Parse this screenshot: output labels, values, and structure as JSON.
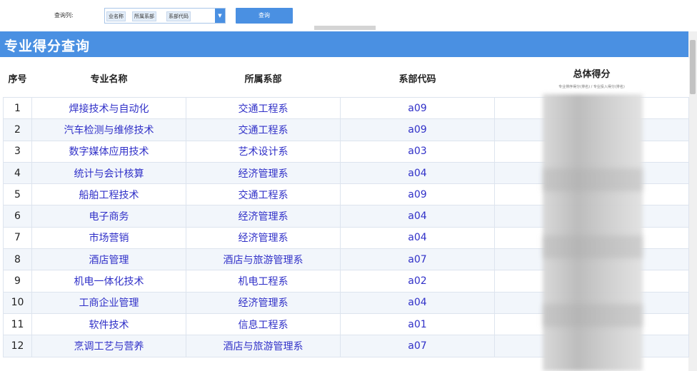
{
  "toolbar": {
    "query_label": "查询列:",
    "selected_tags": [
      "业名称",
      "所属系部",
      "系部代码"
    ],
    "dropdown_arrow": "▼",
    "query_button": "查询"
  },
  "page": {
    "title": "专业得分查询"
  },
  "table": {
    "headers": {
      "index": "序号",
      "major": "专业名称",
      "dept": "所属系部",
      "code": "系部代码",
      "score": "总体得分",
      "score_sub": "专业排序得分(排名) / 专业投入得分(排名)"
    },
    "rows": [
      {
        "index": "1",
        "major": "焊接技术与自动化",
        "dept": "交通工程系",
        "code": "a09"
      },
      {
        "index": "2",
        "major": "汽车检测与维修技术",
        "dept": "交通工程系",
        "code": "a09"
      },
      {
        "index": "3",
        "major": "数字媒体应用技术",
        "dept": "艺术设计系",
        "code": "a03"
      },
      {
        "index": "4",
        "major": "统计与会计核算",
        "dept": "经济管理系",
        "code": "a04"
      },
      {
        "index": "5",
        "major": "船舶工程技术",
        "dept": "交通工程系",
        "code": "a09"
      },
      {
        "index": "6",
        "major": "电子商务",
        "dept": "经济管理系",
        "code": "a04"
      },
      {
        "index": "7",
        "major": "市场营销",
        "dept": "经济管理系",
        "code": "a04"
      },
      {
        "index": "8",
        "major": "酒店管理",
        "dept": "酒店与旅游管理系",
        "code": "a07"
      },
      {
        "index": "9",
        "major": "机电一体化技术",
        "dept": "机电工程系",
        "code": "a02"
      },
      {
        "index": "10",
        "major": "工商企业管理",
        "dept": "经济管理系",
        "code": "a04"
      },
      {
        "index": "11",
        "major": "软件技术",
        "dept": "信息工程系",
        "code": "a01"
      },
      {
        "index": "12",
        "major": "烹调工艺与营养",
        "dept": "酒店与旅游管理系",
        "code": "a07"
      }
    ]
  },
  "colors": {
    "accent": "#4a90e2",
    "link_text": "#3030c8",
    "row_alt": "#f2f6fb"
  }
}
